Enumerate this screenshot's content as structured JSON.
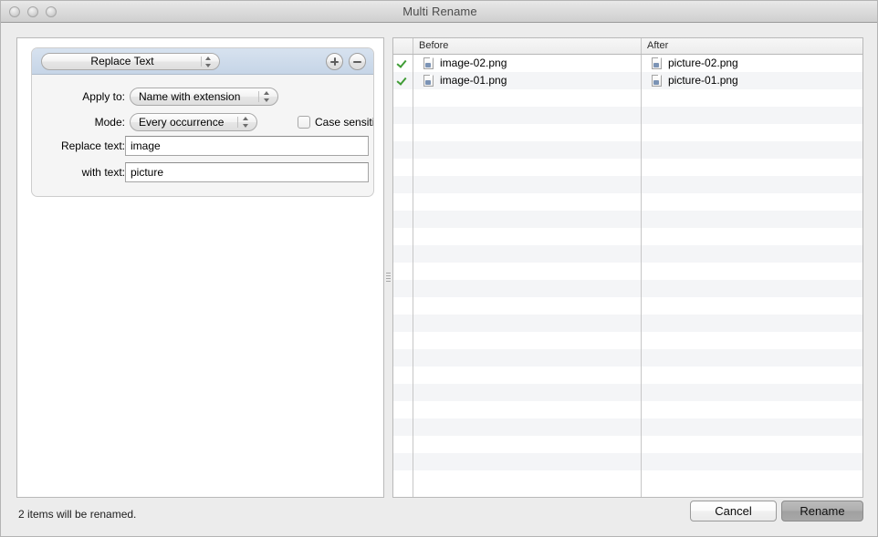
{
  "window": {
    "title": "Multi Rename",
    "traffic_lights": [
      "close-button",
      "minimize-button",
      "zoom-button"
    ]
  },
  "rule_panel": {
    "rule_type": {
      "selected": "Replace Text",
      "icon": "chevron-updown-icon"
    },
    "add_label": "+",
    "remove_label": "−",
    "fields": {
      "apply_to": {
        "label": "Apply to:",
        "value": "Name with extension"
      },
      "mode": {
        "label": "Mode:",
        "value": "Every occurrence"
      },
      "case_sensitive": {
        "label": "Case sensitive",
        "checked": false
      },
      "replace_text": {
        "label": "Replace text:",
        "value": "image",
        "placeholder": ""
      },
      "with_text": {
        "label": "with text:",
        "value": "picture",
        "placeholder": ""
      }
    }
  },
  "file_table": {
    "columns": {
      "check": "",
      "before": "Before",
      "after": "After"
    },
    "rows": [
      {
        "checked": true,
        "before": "image-02.png",
        "after": "picture-02.png",
        "icon": "image-file-icon"
      },
      {
        "checked": true,
        "before": "image-01.png",
        "after": "picture-01.png",
        "icon": "image-file-icon"
      }
    ],
    "empty_row_count": 23
  },
  "footer": {
    "status": "2 items will be renamed.",
    "cancel_label": "Cancel",
    "rename_label": "Rename"
  },
  "colors": {
    "window_background": "#ececec",
    "panel_background": "#ffffff",
    "rule_header": "#c6d5e7",
    "rule_body": "#f5f5f5",
    "row_stripe": "#f4f5f7",
    "check_green": "#3f9c35",
    "default_button": "#a8a8a8"
  }
}
